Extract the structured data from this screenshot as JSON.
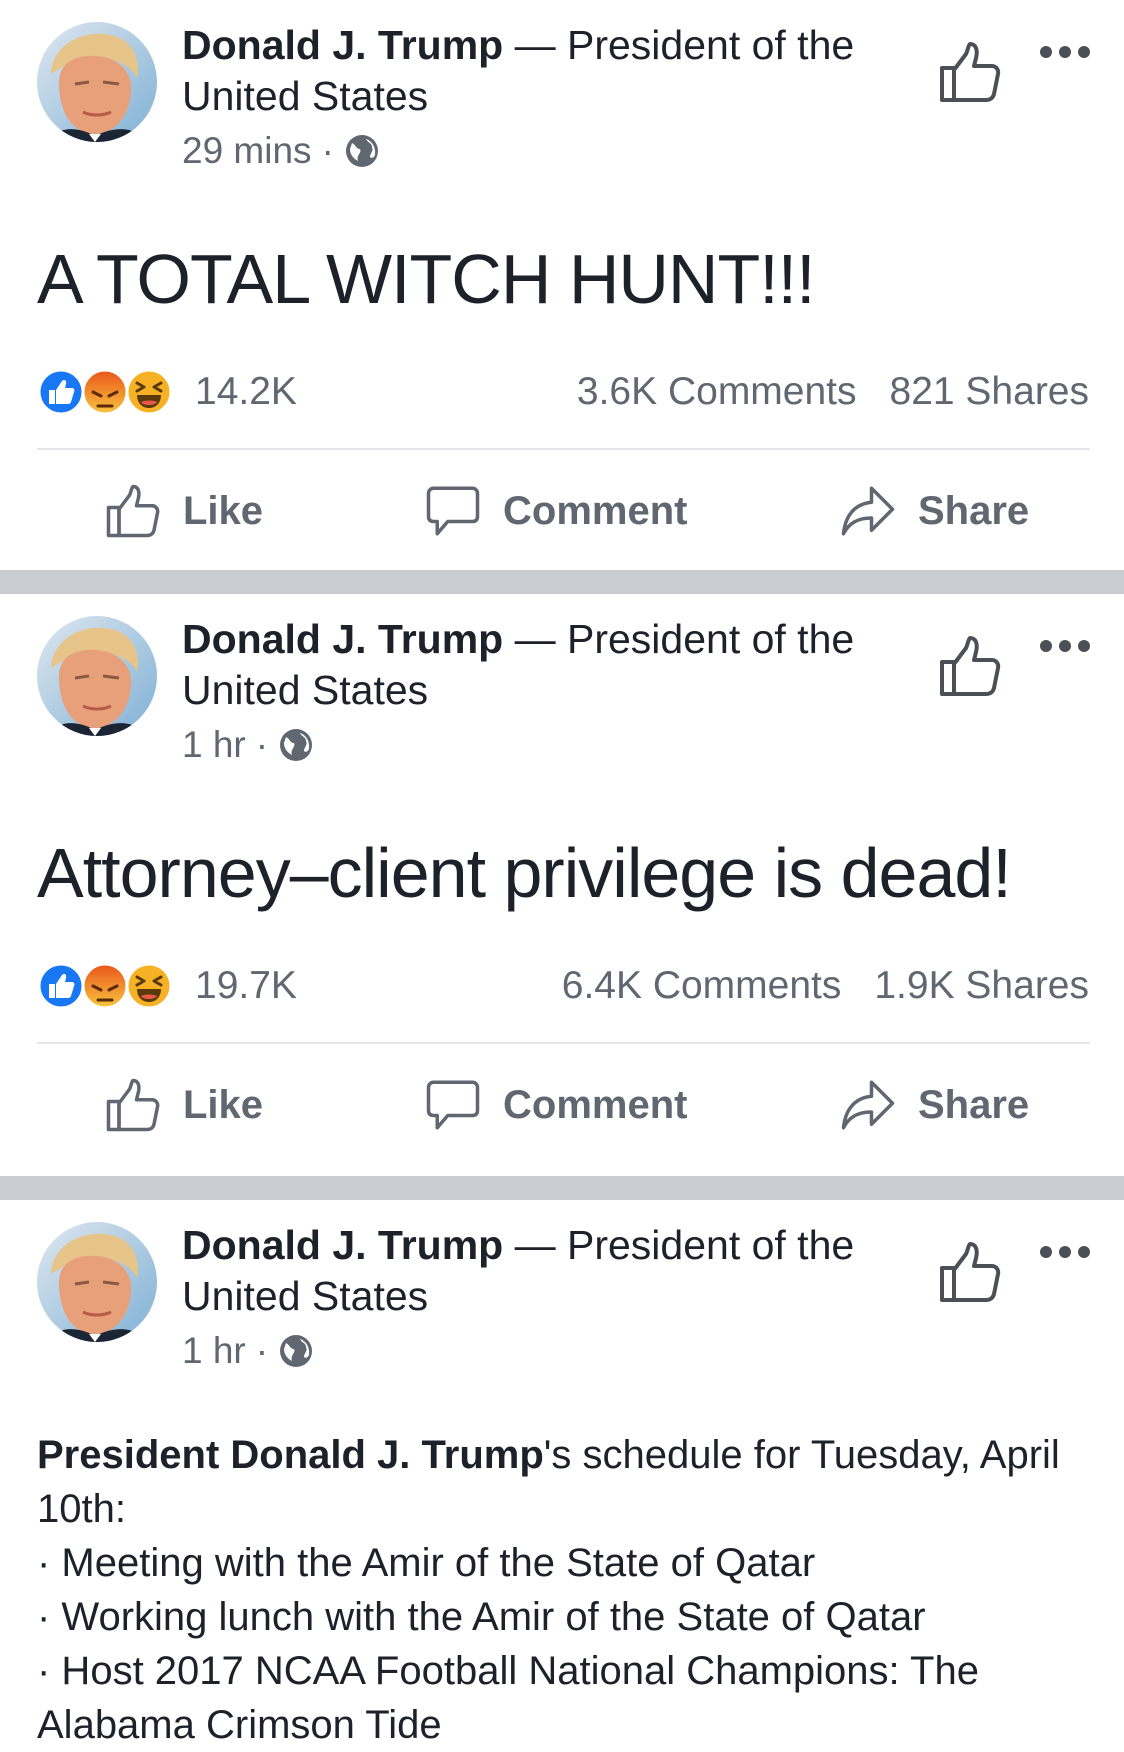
{
  "posts": [
    {
      "author_name": "Donald J. Trump",
      "author_sep": " — ",
      "author_role": "President of the United States",
      "time": "29 mins",
      "dot": "·",
      "body": "A TOTAL WITCH HUNT!!!",
      "reaction_count": "14.2K",
      "comments": "3.6K Comments",
      "shares": "821 Shares",
      "actions": {
        "like": "Like",
        "comment": "Comment",
        "share": "Share"
      }
    },
    {
      "author_name": "Donald J. Trump",
      "author_sep": " — ",
      "author_role": "President of the United States",
      "time": "1 hr",
      "dot": "·",
      "body": "Attorney–client privilege is dead!",
      "reaction_count": "19.7K",
      "comments": "6.4K Comments",
      "shares": "1.9K Shares",
      "actions": {
        "like": "Like",
        "comment": "Comment",
        "share": "Share"
      }
    },
    {
      "author_name": "Donald J. Trump",
      "author_sep": " — ",
      "author_role": "President of the United States",
      "time": "1 hr",
      "dot": "·",
      "schedule": {
        "intro_bold": "President Donald J. Trump",
        "intro_rest": "'s schedule for Tuesday, April 10th:",
        "items": [
          "· Meeting with the Amir of the State of Qatar",
          "· Working lunch with the Amir of the State of Qatar",
          "· Host 2017 NCAA Football National Champions: The Alabama Crimson Tide"
        ]
      }
    }
  ],
  "icons": {
    "avatar": "profile-photo",
    "globe": "globe-icon",
    "header_like": "thumbs-up-outline-icon",
    "more": "more-options-icon",
    "reactions": [
      "like-reaction-icon",
      "angry-reaction-icon",
      "haha-reaction-icon"
    ],
    "like": "thumbs-up-outline-icon",
    "comment": "speech-bubble-icon",
    "share": "share-arrow-icon"
  },
  "colors": {
    "text": "#1d2129",
    "secondary": "#606770",
    "like_blue": "#1877f2",
    "reaction_yellow": "#f7b125",
    "angry_red": "#e9710f",
    "separator": "#c9ccd1"
  }
}
